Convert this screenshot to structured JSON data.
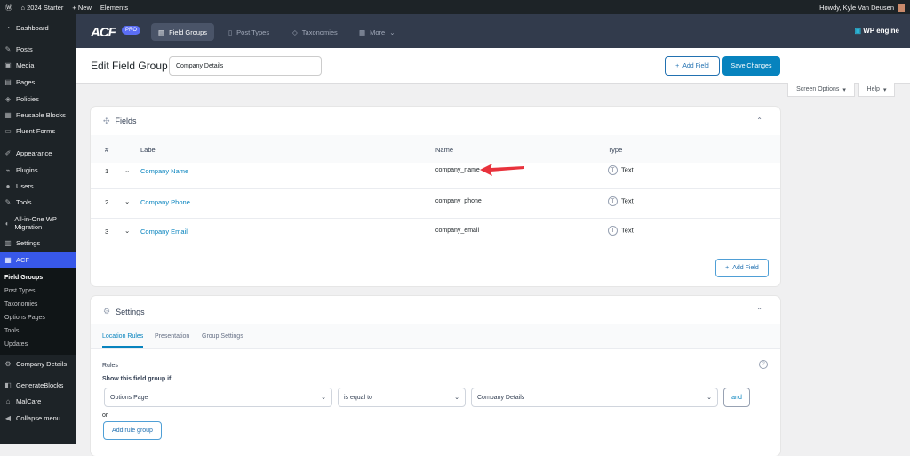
{
  "adminbar": {
    "site": "2024 Starter",
    "new": "New",
    "elements": "Elements",
    "howdy": "Howdy, Kyle Van Deusen"
  },
  "sidebar": {
    "items": [
      "Dashboard",
      "Posts",
      "Media",
      "Pages",
      "Policies",
      "Reusable Blocks",
      "Fluent Forms",
      "Appearance",
      "Plugins",
      "Users",
      "Tools",
      "All-in-One WP Migration",
      "Settings",
      "ACF",
      "Company Details",
      "GenerateBlocks",
      "MalCare",
      "Collapse menu"
    ],
    "acf_sub": [
      "Field Groups",
      "Post Types",
      "Taxonomies",
      "Options Pages",
      "Tools",
      "Updates"
    ]
  },
  "acfbar": {
    "logo": "ACF",
    "pro": "PRO",
    "tabs": [
      "Field Groups",
      "Post Types",
      "Taxonomies",
      "More"
    ],
    "brand": "WP engine"
  },
  "title": {
    "heading": "Edit Field Group",
    "group_name": "Company Details",
    "add_field": "Add Field",
    "save": "Save Changes",
    "screen_options": "Screen Options",
    "help": "Help"
  },
  "fields": {
    "title": "Fields",
    "headers": {
      "num": "#",
      "label": "Label",
      "name": "Name",
      "type": "Type"
    },
    "rows": [
      {
        "num": "1",
        "label": "Company Name",
        "name": "company_name",
        "type": "Text"
      },
      {
        "num": "2",
        "label": "Company Phone",
        "name": "company_phone",
        "type": "Text"
      },
      {
        "num": "3",
        "label": "Company Email",
        "name": "company_email",
        "type": "Text"
      }
    ],
    "add_field": "Add Field"
  },
  "settings": {
    "title": "Settings",
    "tabs": [
      "Location Rules",
      "Presentation",
      "Group Settings"
    ],
    "rules_label": "Rules",
    "show_if": "Show this field group if",
    "rule": {
      "param": "Options Page",
      "operator": "is equal to",
      "value": "Company Details"
    },
    "and": "and",
    "or": "or",
    "add_rule_group": "Add rule group"
  },
  "colors": {
    "accent": "#0783be",
    "acf_bar": "#323b4c",
    "active_menu": "#3858e9",
    "arrow": "#e8323c"
  }
}
